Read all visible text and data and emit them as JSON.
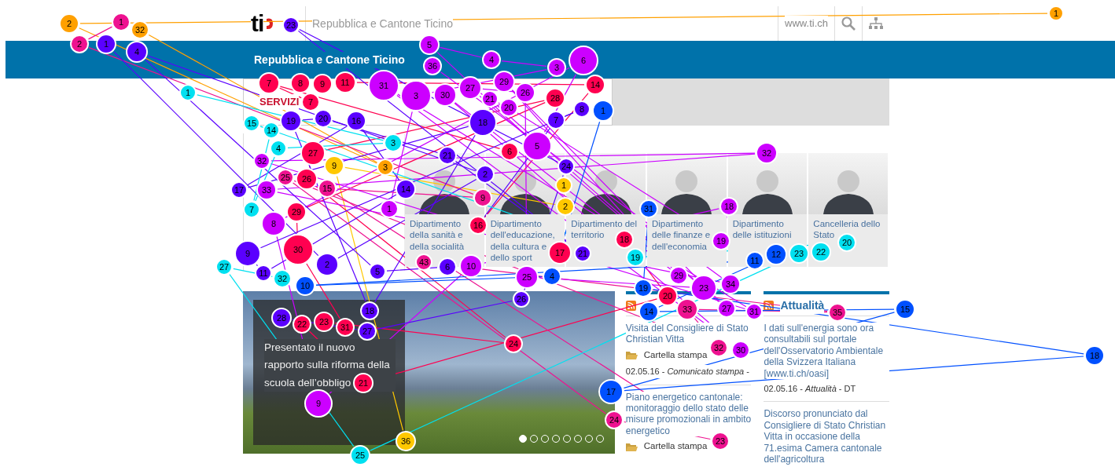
{
  "header": {
    "logo_text": "ti",
    "site_title": "Repubblica e Cantone Ticino",
    "link": "www.ti.ch"
  },
  "banner": {
    "title": "Repubblica e Cantone Ticino"
  },
  "services": {
    "label": "SERVIZI"
  },
  "departments": [
    {
      "label": "Dipartimento della sanità e della socialità"
    },
    {
      "label": "Dipartimento dell'educazione, della cultura e dello sport"
    },
    {
      "label": "Dipartimento del territorio"
    },
    {
      "label": "Dipartimento delle finanze e dell'economia"
    },
    {
      "label": "Dipartimento delle istituzioni"
    },
    {
      "label": "Cancelleria dello Stato"
    }
  ],
  "carousel": {
    "caption": "Presentato il nuovo rapporto sulla riforma della scuola dell’obbligo",
    "dots": [
      {
        "selected": true
      },
      {
        "selected": false
      },
      {
        "selected": false
      },
      {
        "selected": false
      },
      {
        "selected": false
      },
      {
        "selected": false
      },
      {
        "selected": false
      },
      {
        "selected": false
      }
    ]
  },
  "news_columns": [
    {
      "items": [
        {
          "title": "Visita del Consigliere di Stato Christian Vitta",
          "folder": "Cartella stampa",
          "meta": "02.05.16 - *Comunicato stampa* -"
        },
        {
          "title": "Piano energetico cantonale: monitoraggio dello stato delle misure promozionali in ambito energetico",
          "folder": "Cartella stampa"
        }
      ]
    },
    {
      "title": "Attualità",
      "items": [
        {
          "title": "I dati sull'energia sono ora consultabili sul portale dell'Osservatorio Ambientale della Svizzera Italiana [www.ti.ch/oasi]",
          "meta": "02.05.16 - *Attualità* - DT"
        },
        {
          "title": "Discorso pronunciato dal Consigliere di Stato Christian Vitta in occasione della 71.esima Camera cantonale dell'agricoltura"
        }
      ]
    }
  ],
  "gaze_plot": {
    "participants": [
      {
        "color": "#ffa000",
        "fixations": [
          "1",
          "2",
          "3",
          "32"
        ]
      },
      {
        "color": "#ffc800",
        "fixations": [
          "1",
          "2",
          "9",
          "36"
        ]
      },
      {
        "color": "#ff0050",
        "fixations": [
          "6",
          "7",
          "7",
          "8",
          "9",
          "11",
          "14",
          "16",
          "17",
          "18",
          "20",
          "21",
          "22",
          "23",
          "24",
          "26",
          "27",
          "28",
          "29",
          "30",
          "31"
        ]
      },
      {
        "color": "#ee1290",
        "fixations": [
          "1",
          "2",
          "9",
          "15",
          "23",
          "24",
          "25",
          "32",
          "33",
          "35",
          "43"
        ]
      },
      {
        "color": "#cc00ff",
        "fixations": [
          "1",
          "3",
          "3",
          "4",
          "5",
          "5",
          "6",
          "8",
          "9",
          "10",
          "18",
          "19",
          "20",
          "21",
          "23",
          "25",
          "26",
          "27",
          "27",
          "29",
          "29",
          "30",
          "30",
          "31",
          "31",
          "32",
          "32",
          "33",
          "34",
          "36"
        ]
      },
      {
        "color": "#5a00ff",
        "fixations": [
          "1",
          "2",
          "2",
          "4",
          "5",
          "6",
          "7",
          "8",
          "9",
          "11",
          "14",
          "16",
          "17",
          "18",
          "18",
          "19",
          "20",
          "21",
          "21",
          "23",
          "24",
          "26",
          "27",
          "28"
        ]
      },
      {
        "color": "#00e0f0",
        "fixations": [
          "1",
          "3",
          "4",
          "7",
          "14",
          "15",
          "19",
          "20",
          "22",
          "23",
          "25",
          "27",
          "32"
        ]
      },
      {
        "color": "#0050ff",
        "fixations": [
          "1",
          "4",
          "10",
          "11",
          "12",
          "14",
          "15",
          "17",
          "18",
          "19",
          "31"
        ]
      }
    ]
  }
}
